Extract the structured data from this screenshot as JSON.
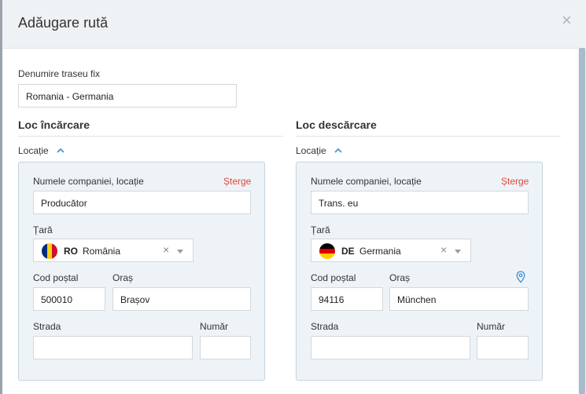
{
  "modal": {
    "title": "Adăugare rută",
    "close_glyph": "×"
  },
  "route_name": {
    "label": "Denumire traseu fix",
    "value": "Romania - Germania"
  },
  "loading": {
    "section_title": "Loc încărcare",
    "location_toggle": "Locație",
    "company_label": "Numele companiei, locație",
    "delete_label": "Șterge",
    "company_value": "Producător",
    "country_label": "Țară",
    "country_code": "RO",
    "country_name": "România",
    "flag_colors": [
      "#002b7f",
      "#fcd116",
      "#ce1126"
    ],
    "postal_label": "Cod poștal",
    "postal_value": "500010",
    "city_label": "Oraș",
    "city_value": "Brașov",
    "street_label": "Strada",
    "street_value": "",
    "number_label": "Număr",
    "number_value": ""
  },
  "unloading": {
    "section_title": "Loc descărcare",
    "location_toggle": "Locație",
    "company_label": "Numele companiei, locație",
    "delete_label": "Șterge",
    "company_value": "Trans. eu",
    "country_label": "Țară",
    "country_code": "DE",
    "country_name": "Germania",
    "flag_colors": [
      "#000000",
      "#dd0000",
      "#ffce00"
    ],
    "postal_label": "Cod poștal",
    "postal_value": "94116",
    "city_label": "Oraș",
    "city_value": "München",
    "street_label": "Strada",
    "street_value": "",
    "number_label": "Număr",
    "number_value": "",
    "map_pin_icon": "map-pin-icon"
  },
  "colors": {
    "accent": "#3a8fd0",
    "delete": "#e0463d",
    "panel_bg": "#eef3f7",
    "header_bg": "#eef2f5"
  }
}
